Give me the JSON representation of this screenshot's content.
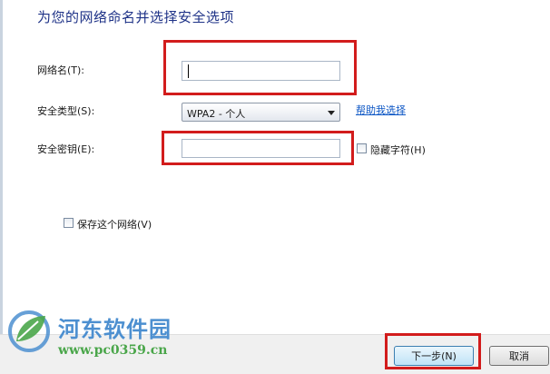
{
  "dialog": {
    "title": "为您的网络命名并选择安全选项"
  },
  "form": {
    "network_name": {
      "label": "网络名(T):",
      "value": ""
    },
    "security_type": {
      "label": "安全类型(S):",
      "selected": "WPA2 - 个人",
      "help_link": "帮助我选择"
    },
    "security_key": {
      "label": "安全密钥(E):",
      "value": "",
      "hide_chars_label": "隐藏字符(H)",
      "hide_chars_checked": false
    },
    "save_network": {
      "label": "保存这个网络(V)",
      "checked": false
    }
  },
  "footer": {
    "next_label": "下一步(N)",
    "cancel_label": "取消"
  },
  "watermark": {
    "title": "河东软件园",
    "url": "www.pc0359.cn"
  },
  "colors": {
    "title": "#1e3287",
    "link": "#0b55c4",
    "highlight": "#d21c1c",
    "watermark_blue": "#4c8fd0",
    "watermark_green": "#4aa64a"
  },
  "icons": {
    "dropdown": "chevron-down-icon",
    "watermark_logo": "leaf-logo-icon"
  }
}
